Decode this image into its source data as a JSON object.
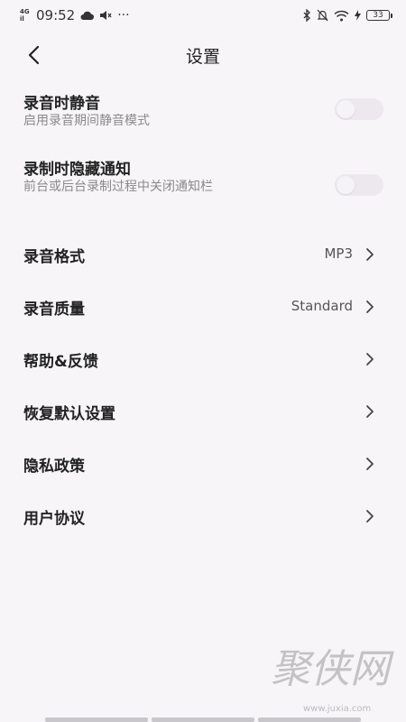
{
  "status_bar": {
    "network": "4G",
    "network_sub": "il",
    "time": "09:52",
    "more": "···",
    "battery": "33"
  },
  "header": {
    "title": "设置"
  },
  "toggles": [
    {
      "title": "录音时静音",
      "desc": "启用录音期间静音模式",
      "on": false
    },
    {
      "title": "录制时隐藏通知",
      "desc": "前台或后台录制过程中关闭通知栏",
      "on": false
    }
  ],
  "menu": [
    {
      "label": "录音格式",
      "value": "MP3"
    },
    {
      "label": "录音质量",
      "value": "Standard"
    },
    {
      "label": "帮助&反馈",
      "value": ""
    },
    {
      "label": "恢复默认设置",
      "value": ""
    },
    {
      "label": "隐私政策",
      "value": ""
    },
    {
      "label": "用户协议",
      "value": ""
    }
  ],
  "watermark": {
    "text": "聚侠网",
    "url": "www.juxia.com"
  },
  "colors": {
    "background": "#f7f5f8",
    "switch_off": "#ece8ee",
    "text": "#222222",
    "secondary_text": "#8a8a8a"
  }
}
